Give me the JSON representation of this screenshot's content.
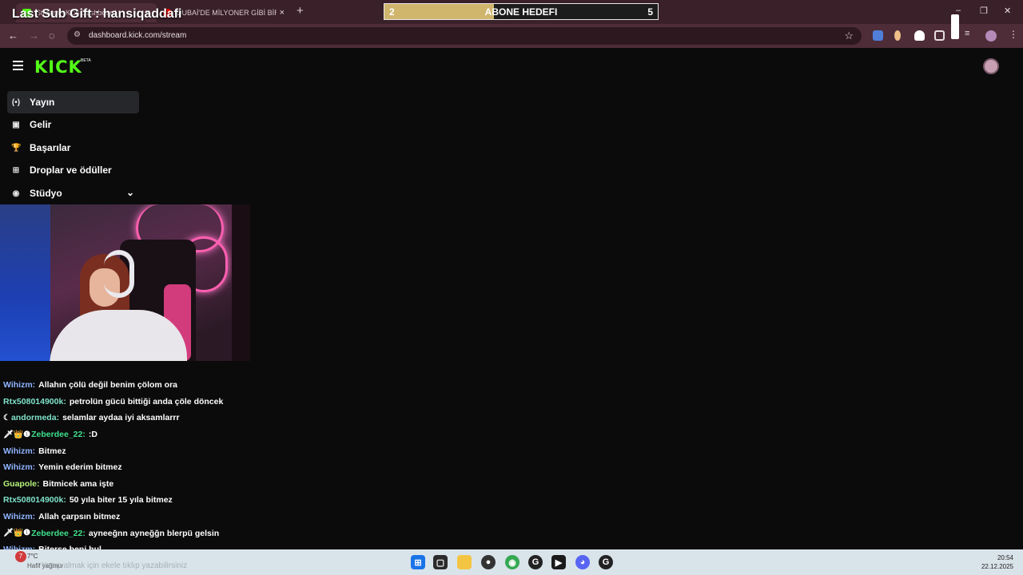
{
  "browser": {
    "tabs": [
      {
        "title": "Stream - Kick Dashboard",
        "close": "×"
      },
      {
        "title": "DUBAİ'DE MİLYONER GİBİ BİR GÜN",
        "close": "×"
      }
    ],
    "new_tab": "+",
    "url": "dashboard.kick.com/stream",
    "window_controls": {
      "minimize": "–",
      "maximize": "❐",
      "close": "✕"
    }
  },
  "overlay": {
    "last_sub": "Last Sub Gift : hansiqaddafi",
    "goal": {
      "current": "2",
      "label": "ABONE HEDEFI",
      "target": "5",
      "progress": 0.4
    }
  },
  "dashboard": {
    "logo": "KICK",
    "beta": "BETA",
    "menu": [
      {
        "label": "Yayın",
        "icon": "broadcast-icon",
        "glyph": "(•)"
      },
      {
        "label": "Gelir",
        "icon": "revenue-icon",
        "glyph": "▣"
      },
      {
        "label": "Başarılar",
        "icon": "trophy-icon",
        "glyph": "🏆"
      },
      {
        "label": "Droplar ve ödüller",
        "icon": "gift-icon",
        "glyph": "⊞"
      },
      {
        "label": "Stüdyo",
        "icon": "studio-icon",
        "glyph": "◉"
      }
    ],
    "chevron": "⌄"
  },
  "chat": [
    {
      "badges": "",
      "user": "Wihizm:",
      "color": "#8fb4ff",
      "text": "Allahın çölü değil benim çölom ora"
    },
    {
      "badges": "",
      "user": "Rtx508014900k:",
      "color": "#7fe3c9",
      "text": "petrolün gücü bittiği anda çöle döncek"
    },
    {
      "badges": "☾",
      "user": "andormeda:",
      "color": "#7fe3c9",
      "text": "selamlar aydaa iyi aksamlarrr"
    },
    {
      "badges": "🗡👑❶",
      "user": "Zeberdee_22:",
      "color": "#3fe08a",
      "text": ":D"
    },
    {
      "badges": "",
      "user": "Wihizm:",
      "color": "#8fb4ff",
      "text": "Bitmez"
    },
    {
      "badges": "",
      "user": "Wihizm:",
      "color": "#8fb4ff",
      "text": "Yemin ederim bitmez"
    },
    {
      "badges": "",
      "user": "Guapole:",
      "color": "#b4f27a",
      "text": "Bitmicek ama işte"
    },
    {
      "badges": "",
      "user": "Rtx508014900k:",
      "color": "#7fe3c9",
      "text": "50 yıla biter 15 yıla bitmez"
    },
    {
      "badges": "",
      "user": "Wihizm:",
      "color": "#8fb4ff",
      "text": "Allah çarpsın bitmez"
    },
    {
      "badges": "🗡👑❶",
      "user": "Zeberdee_22:",
      "color": "#3fe08a",
      "text": "ayneeğnn ayneğğn blerpü gelsin"
    },
    {
      "badges": "",
      "user": "Wihizm:",
      "color": "#8fb4ff",
      "text": "Biterse beni bul"
    }
  ],
  "taskbar": {
    "weather_badge": "7",
    "temperature": "7°C",
    "weather_desc": "Hafif yağmur",
    "ghost_text": "Yazıp almak için ekele tıklıp yazabilirsiniz",
    "time": "20:54",
    "date": "22.12.2025"
  },
  "colors": {
    "kick_green": "#53fc18",
    "goal_fill": "#d0b56d",
    "tab_bg": "#3a2029"
  }
}
